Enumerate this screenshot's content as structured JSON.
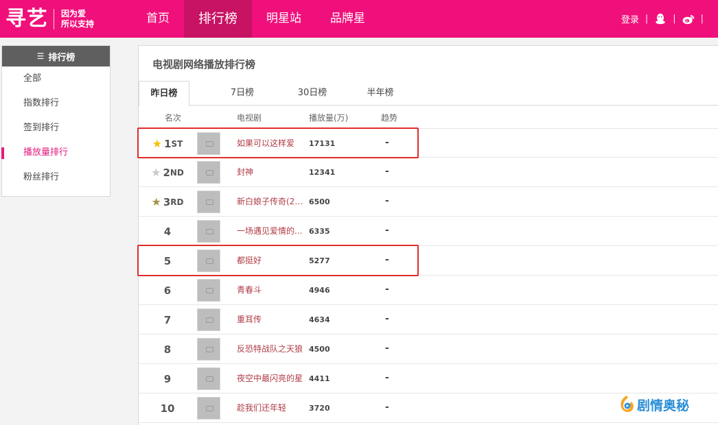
{
  "header": {
    "logo_text": "寻艺",
    "slogan_line1": "因为爱",
    "slogan_line2": "所以支持",
    "nav": [
      {
        "label": "首页"
      },
      {
        "label": "排行榜"
      },
      {
        "label": "明星站"
      },
      {
        "label": "品牌星"
      }
    ],
    "login": "登录",
    "separator": "|"
  },
  "sidebar": {
    "title": "排行榜",
    "items": [
      {
        "label": "全部"
      },
      {
        "label": "指数排行"
      },
      {
        "label": "签到排行"
      },
      {
        "label": "播放量排行"
      },
      {
        "label": "粉丝排行"
      }
    ]
  },
  "main": {
    "title": "电视剧网络播放排行榜",
    "tabs": [
      {
        "label": "昨日榜"
      },
      {
        "label": "7日榜"
      },
      {
        "label": "30日榜"
      },
      {
        "label": "半年榜"
      }
    ],
    "columns": {
      "rank": "名次",
      "drama": "电视剧",
      "plays": "播放量(万)",
      "trend": "趋势"
    },
    "rows": [
      {
        "rank": "1",
        "suffix": "ST",
        "star": "gold",
        "title": "如果可以这样爱",
        "plays": "17131",
        "trend": "-"
      },
      {
        "rank": "2",
        "suffix": "ND",
        "star": "silver",
        "title": "封神",
        "plays": "12341",
        "trend": "-"
      },
      {
        "rank": "3",
        "suffix": "RD",
        "star": "bronze",
        "title": "新白娘子传奇(20...",
        "plays": "6500",
        "trend": "-"
      },
      {
        "rank": "4",
        "suffix": "",
        "star": "",
        "title": "一场遇见爱情的...",
        "plays": "6335",
        "trend": "-"
      },
      {
        "rank": "5",
        "suffix": "",
        "star": "",
        "title": "都挺好",
        "plays": "5277",
        "trend": "-"
      },
      {
        "rank": "6",
        "suffix": "",
        "star": "",
        "title": "青春斗",
        "plays": "4946",
        "trend": "-"
      },
      {
        "rank": "7",
        "suffix": "",
        "star": "",
        "title": "重耳传",
        "plays": "4634",
        "trend": "-"
      },
      {
        "rank": "8",
        "suffix": "",
        "star": "",
        "title": "反恐特战队之天狼",
        "plays": "4500",
        "trend": "-"
      },
      {
        "rank": "9",
        "suffix": "",
        "star": "",
        "title": "夜空中最闪亮的星",
        "plays": "4411",
        "trend": "-"
      },
      {
        "rank": "10",
        "suffix": "",
        "star": "",
        "title": "趁我们还年轻",
        "plays": "3720",
        "trend": "-"
      }
    ]
  },
  "colors": {
    "brand": "#f0107b",
    "nav_active": "#c81264",
    "sidebar_active": "#e4197f",
    "title_link": "#b03c46",
    "highlight": "#e02b2b",
    "star_gold": "#f2c200",
    "star_silver": "#c8c8c8",
    "star_bronze": "#a8924a"
  },
  "watermark": {
    "text": "剧情奥秘"
  }
}
